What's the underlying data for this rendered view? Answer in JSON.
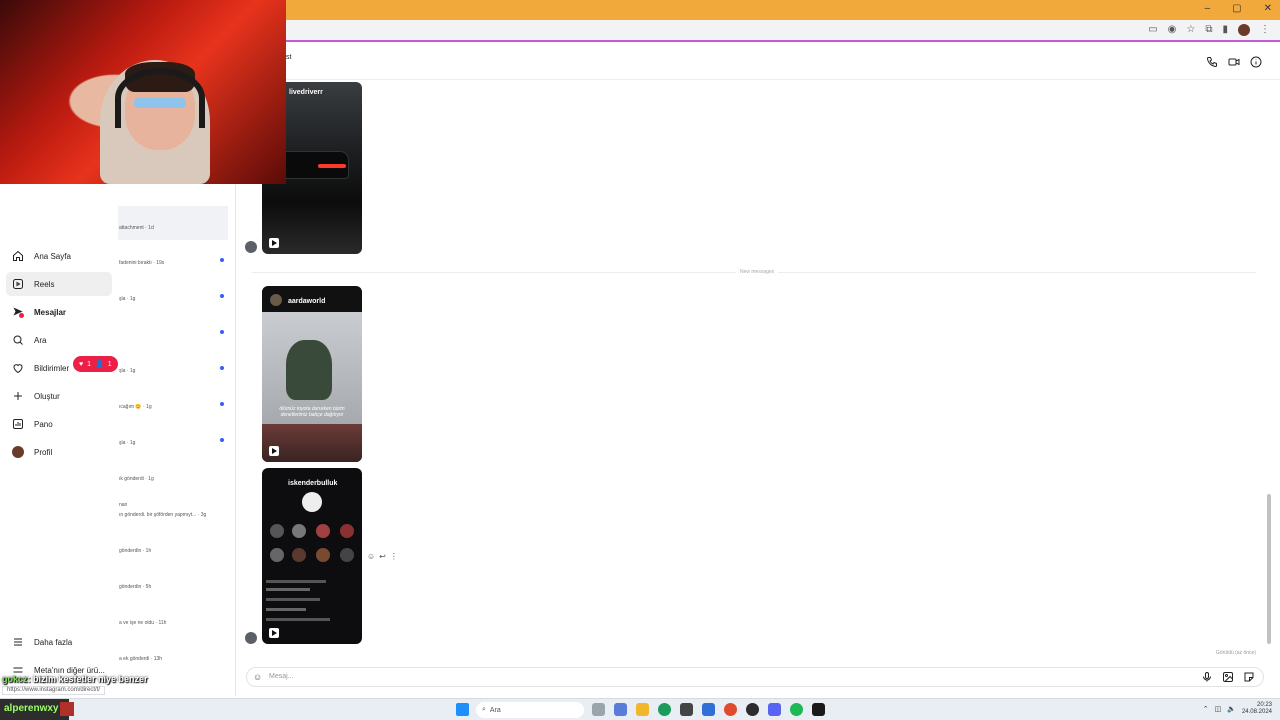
{
  "browser": {
    "window_controls": [
      "–",
      "▢",
      "✕"
    ]
  },
  "chat": {
    "header_title_fragment": "st",
    "new_messages_label": "New messages",
    "seen_label": "Görüldü (az önce)",
    "composer_placeholder": "Mesaj..."
  },
  "nav": {
    "items": [
      {
        "label": "Ana Sayfa",
        "icon": "home-icon"
      },
      {
        "label": "Reels",
        "icon": "reels-icon"
      },
      {
        "label": "Mesajlar",
        "icon": "messages-icon"
      },
      {
        "label": "Ara",
        "icon": "search-icon"
      },
      {
        "label": "Bildirimler",
        "icon": "heart-icon"
      },
      {
        "label": "Oluştur",
        "icon": "plus-icon"
      },
      {
        "label": "Pano",
        "icon": "dashboard-icon"
      },
      {
        "label": "Profil",
        "icon": "profile-avatar"
      }
    ],
    "more_label": "Daha fazla",
    "meta_label": "Meta'nın diğer ürü...",
    "notification_likes": "1",
    "notification_follows": "1"
  },
  "conversations": [
    {
      "preview": "attachment · 1d",
      "unread": false
    },
    {
      "preview": "fadenini bıraktı · 19s",
      "unread": true
    },
    {
      "preview": "şla · 1g",
      "unread": true
    },
    {
      "preview": "",
      "unread": true
    },
    {
      "preview": "şla · 1g",
      "unread": true
    },
    {
      "preview": "ıcağım 😊 · 1g",
      "unread": true
    },
    {
      "preview": "şla · 1g",
      "unread": true
    },
    {
      "preview": "ık gönderdi · 1g",
      "unread": false
    },
    {
      "preview": "nan",
      "unread": false
    },
    {
      "preview": "ın gönderdi. bir şöförden yapmıyt... · 3g",
      "unread": false
    },
    {
      "preview": "gönderdin · 1h",
      "unread": false
    },
    {
      "preview": "gönderdin · 5h",
      "unread": false
    },
    {
      "preview": "a ve işe ne oldu · 11h",
      "unread": false
    },
    {
      "preview": "a ek gönderdi · 13h",
      "unread": false
    }
  ],
  "reels": [
    {
      "username": "livedriverr"
    },
    {
      "username": "aardaworld",
      "caption": "ölümüz toyota dururken bizim denetlerimiz bahçe dağıtıyor"
    },
    {
      "username": "iskenderbulluk"
    }
  ],
  "caption_overlay": {
    "user": "gokcz",
    "text": ": bizim kesfetler niye benzer",
    "status_url": "https://www.instagram.com/direct/t/"
  },
  "taskbar": {
    "user_label": "alperenwxy",
    "search_placeholder": "Ara",
    "time": "20:23",
    "date": "24.08.2024"
  }
}
